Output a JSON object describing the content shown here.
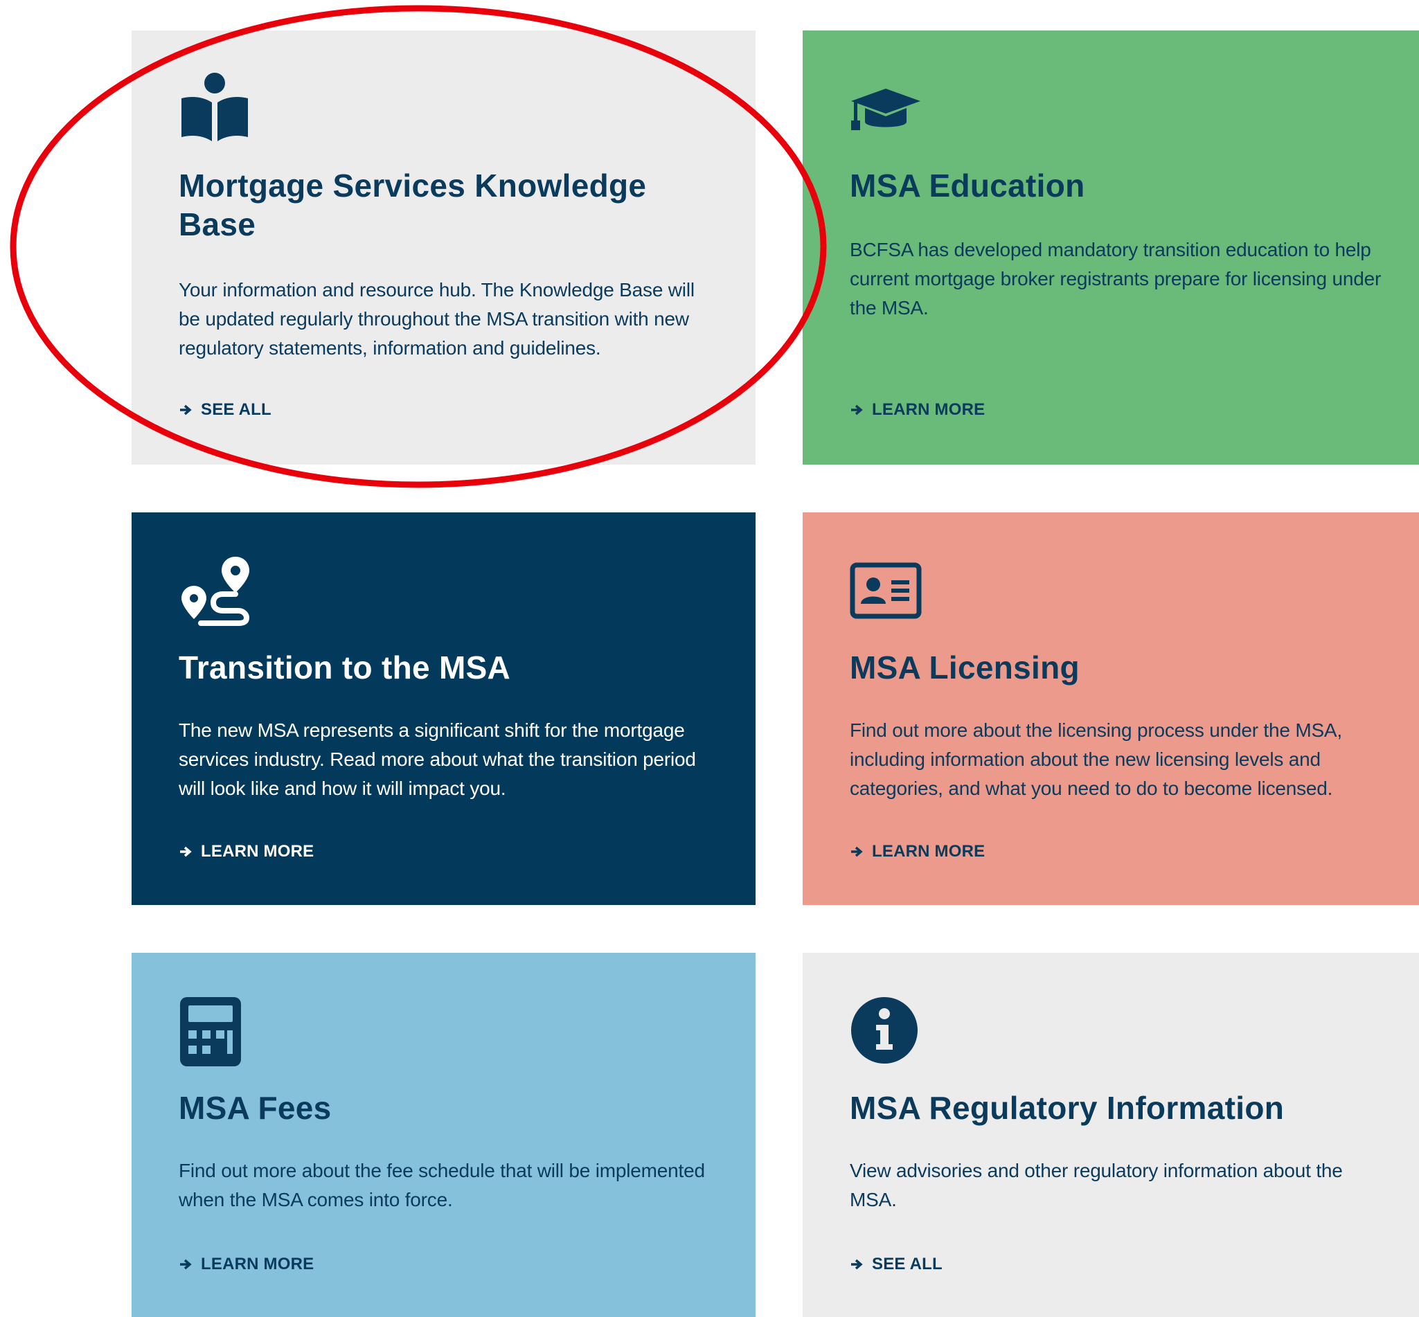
{
  "colors": {
    "navy": "#033a5c",
    "text_navy": "#0a3a5c",
    "gray_card": "#ececec",
    "green_card": "#6aba7a",
    "salmon_card": "#ec9a8c",
    "blue_card": "#86c1dc",
    "annotation_red": "#e8000b"
  },
  "cards": [
    {
      "id": "knowledge-base",
      "icon": "reader-book-icon",
      "title": "Mortgage Services Knowledge Base",
      "body": "Your information and resource hub. The Knowledge Base will be updated regularly throughout the MSA transition with new regulatory statements, information and guidelines.",
      "cta": "SEE ALL"
    },
    {
      "id": "education",
      "icon": "graduation-cap-icon",
      "title": "MSA Education",
      "body": "BCFSA has developed mandatory transition education to help current mortgage broker registrants prepare for licensing under the MSA.",
      "cta": "LEARN MORE"
    },
    {
      "id": "transition",
      "icon": "route-icon",
      "title": "Transition to the MSA",
      "body": "The new MSA represents a significant shift for the mortgage services industry. Read more about what the transition period will look like and how it will impact you.",
      "cta": "LEARN MORE"
    },
    {
      "id": "licensing",
      "icon": "id-card-icon",
      "title": "MSA Licensing",
      "body": "Find out more about the licensing process under the MSA, including information about the new licensing levels and categories, and what you need to do to become licensed.",
      "cta": "LEARN MORE"
    },
    {
      "id": "fees",
      "icon": "calculator-icon",
      "title": "MSA Fees",
      "body": "Find out more about the fee schedule that will be implemented when the MSA comes into force.",
      "cta": "LEARN MORE"
    },
    {
      "id": "regulatory",
      "icon": "info-circle-icon",
      "title": "MSA Regulatory Information",
      "body": "View advisories and other regulatory information about the MSA.",
      "cta": "SEE ALL"
    }
  ]
}
